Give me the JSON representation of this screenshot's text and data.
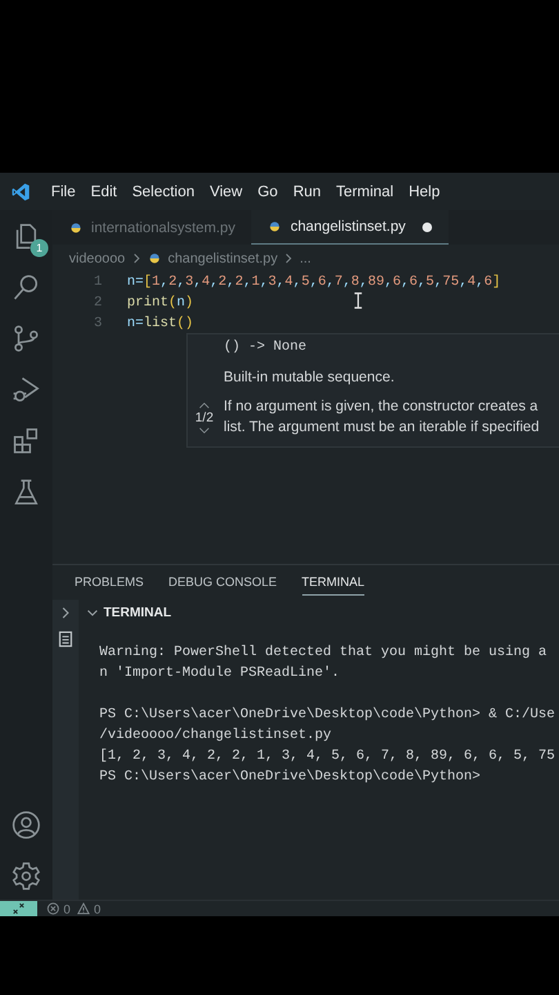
{
  "menu_bar": [
    "File",
    "Edit",
    "Selection",
    "View",
    "Go",
    "Run",
    "Terminal",
    "Help"
  ],
  "activity_bar": {
    "explorer_badge": "1"
  },
  "tabs": [
    {
      "label": "internationalsystem.py",
      "selected": false,
      "modified": false
    },
    {
      "label": "changelistinset.py",
      "selected": true,
      "modified": true
    }
  ],
  "breadcrumb": [
    "videoooo",
    "changelistinset.py",
    "..."
  ],
  "editor": {
    "lines": [
      {
        "number": "1",
        "code": "n=[1,2,3,4,2,2,1,3,4,5,6,7,8,89,6,6,5,75,4,6]"
      },
      {
        "number": "2",
        "code": "print(n)"
      },
      {
        "number": "3",
        "code": "n=list()"
      }
    ]
  },
  "hover": {
    "signature": "() -> None",
    "summary": "Built-in mutable sequence.",
    "doc_lines": [
      "If no argument is given, the constructor creates a",
      "list. The argument must be an iterable if specified"
    ],
    "overload": "1/2"
  },
  "panel": {
    "tabs": [
      {
        "label": "PROBLEMS",
        "selected": false
      },
      {
        "label": "DEBUG CONSOLE",
        "selected": false
      },
      {
        "label": "TERMINAL",
        "selected": true
      }
    ],
    "section_title": "TERMINAL",
    "terminal_blocks": [
      [
        "Warning: PowerShell detected that you might be using a",
        "n 'Import-Module PSReadLine'."
      ],
      [
        "PS C:\\Users\\acer\\OneDrive\\Desktop\\code\\Python> & C:/Use",
        "/videoooo/changelistinset.py",
        "[1, 2, 3, 4, 2, 2, 1, 3, 4, 5, 6, 7, 8, 89, 6, 6, 5, 75",
        "PS C:\\Users\\acer\\OneDrive\\Desktop\\code\\Python>"
      ]
    ]
  },
  "status_bar": {
    "errors": "0",
    "warnings": "0"
  }
}
